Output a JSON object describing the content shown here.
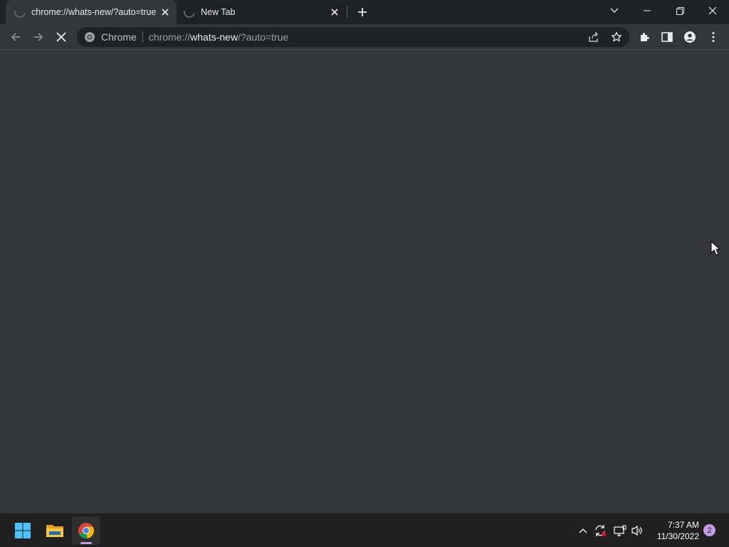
{
  "tabs": [
    {
      "title": "chrome://whats-new/?auto=true",
      "state": "loading",
      "active": true
    },
    {
      "title": "New Tab",
      "state": "loading",
      "active": false
    }
  ],
  "omnibox": {
    "chip_label": "Chrome",
    "url_prefix": "chrome://",
    "url_host": "whats-new",
    "url_path": "/?auto=true"
  },
  "taskbar": {
    "apps": [
      "windows-start",
      "file-explorer",
      "google-chrome"
    ],
    "active_app": "google-chrome",
    "time": "7:37 AM",
    "date": "11/30/2022",
    "notification_count": "2"
  },
  "colors": {
    "tabstrip_bg": "#202124",
    "toolbar_bg": "#35363a",
    "omnibox_bg": "#202124",
    "taskbar_bg": "#202020",
    "accent_badge": "#c59ae7"
  }
}
